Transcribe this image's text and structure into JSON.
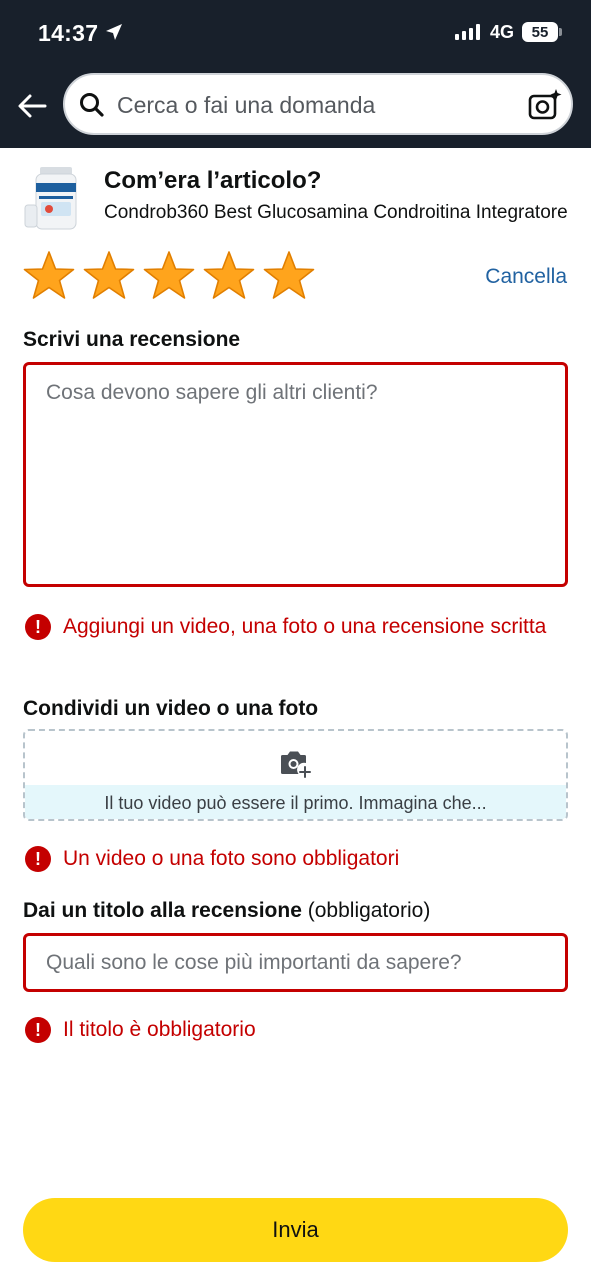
{
  "status_bar": {
    "time": "14:37",
    "network": "4G",
    "battery": "55"
  },
  "header": {
    "search_placeholder": "Cerca o fai una domanda"
  },
  "product": {
    "heading": "Com’era l’articolo?",
    "name": "Condrob360 Best Glucosamina Condroitina Integratore"
  },
  "rating": {
    "stars_selected": 5,
    "stars_total": 5,
    "clear_label": "Cancella"
  },
  "review": {
    "label": "Scrivi una recensione",
    "placeholder": "Cosa devono sapere gli altri clienti?",
    "value": "",
    "error": "Aggiungi un video, una foto o una recensione scritta"
  },
  "media": {
    "label": "Condividi un video o una foto",
    "prompt": "Il tuo video può essere il primo. Immagina che...",
    "error": "Un video o una foto sono obbligatori"
  },
  "title": {
    "label": "Dai un titolo alla recensione",
    "required_note": "(obbligatorio)",
    "placeholder": "Quali sono le cose più importanti da sapere?",
    "value": "",
    "error": "Il titolo è obbligatorio"
  },
  "submit_label": "Invia",
  "colors": {
    "header_bg": "#18202b",
    "error": "#c40000",
    "link": "#2162a1",
    "star": "#ffa41c",
    "submit_bg": "#ffd814"
  }
}
